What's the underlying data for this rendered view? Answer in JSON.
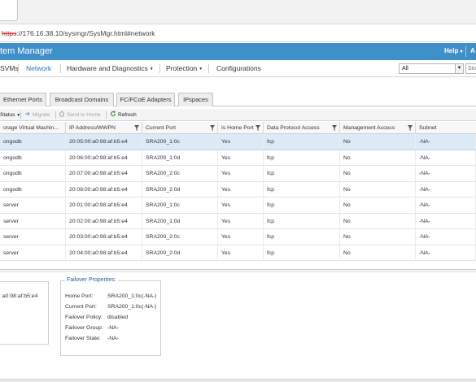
{
  "browser": {
    "url_scheme": "https",
    "url_rest": "://176.16.38.10/sysmgr/SysMgr.html#network"
  },
  "app": {
    "title": "tem Manager",
    "help_label": "Help",
    "cut_label": "A"
  },
  "menu": {
    "items": [
      "SVMs",
      "Network",
      "Hardware and Diagnostics",
      "Protection",
      "Configurations"
    ],
    "active": "Network",
    "filter_value": "All",
    "search_placeholder": "Sea"
  },
  "subtabs": [
    "Ethernet Ports",
    "Broadcast Domains",
    "FC/FCoE Adapters",
    "IPspaces"
  ],
  "toolbar": {
    "status_label": "Status",
    "migrate_label": "Migrate",
    "send_home_label": "Send to Home",
    "refresh_label": "Refresh"
  },
  "table": {
    "columns": [
      "orage Virtual Machin...",
      "IP Address/WWPN",
      "Current Port",
      "Is Home Port",
      "Data Protocol Access",
      "Management Access",
      "Subnet"
    ],
    "rows": [
      [
        "ongodb",
        "20:05:00:a0:98:af:b5:e4",
        "SRA200_1:0c",
        "Yes",
        "fcp",
        "No",
        "-NA-"
      ],
      [
        "ongodb",
        "20:06:00:a0:98:af:b5:e4",
        "SRA200_1:0d",
        "Yes",
        "fcp",
        "No",
        "-NA-"
      ],
      [
        "ongodb",
        "20:07:00:a0:98:af:b5:e4",
        "SRA200_2:0c",
        "Yes",
        "fcp",
        "No",
        "-NA-"
      ],
      [
        "ongodb",
        "20:08:00:a0:98:af:b5:e4",
        "SRA200_2:0d",
        "Yes",
        "fcp",
        "No",
        "-NA-"
      ],
      [
        "server",
        "20:01:00:a0:98:af:b5:e4",
        "SRA200_1:0c",
        "Yes",
        "fcp",
        "No",
        "-NA-"
      ],
      [
        "server",
        "20:02:00:a0:98:af:b5:e4",
        "SRA200_1:0d",
        "Yes",
        "fcp",
        "No",
        "-NA-"
      ],
      [
        "server",
        "20:03:00:a0:98:af:b5:e4",
        "SRA200_2:0c",
        "Yes",
        "fcp",
        "No",
        "-NA-"
      ],
      [
        "server",
        "20:04:00:a0:98:af:b5:e4",
        "SRA200_2:0d",
        "Yes",
        "fcp",
        "No",
        "-NA-"
      ]
    ],
    "selected_row": 0
  },
  "details": {
    "left_value": ":a0:98:af:b5:e4",
    "failover": {
      "title": "Failover Properties:",
      "fields": [
        {
          "label": "Home Port:",
          "value": "SRA200_1:0c(-NA-)"
        },
        {
          "label": "Current Port:",
          "value": "SRA200_1:0c(-NA-)"
        },
        {
          "label": "Failover Policy:",
          "value": "disabled"
        },
        {
          "label": "Failover Group:",
          "value": "-NA-"
        },
        {
          "label": "Failover State:",
          "value": "-NA-"
        }
      ]
    }
  },
  "colors": {
    "appbar": "#3f8fc9",
    "active_menu": "#2a75b8",
    "selected_row": "#dce9f7",
    "legend": "#1f5fa0"
  },
  "icons": [
    "filter-icon",
    "migrate-icon",
    "send-home-icon",
    "refresh-icon",
    "dropdown-caret-icon"
  ]
}
